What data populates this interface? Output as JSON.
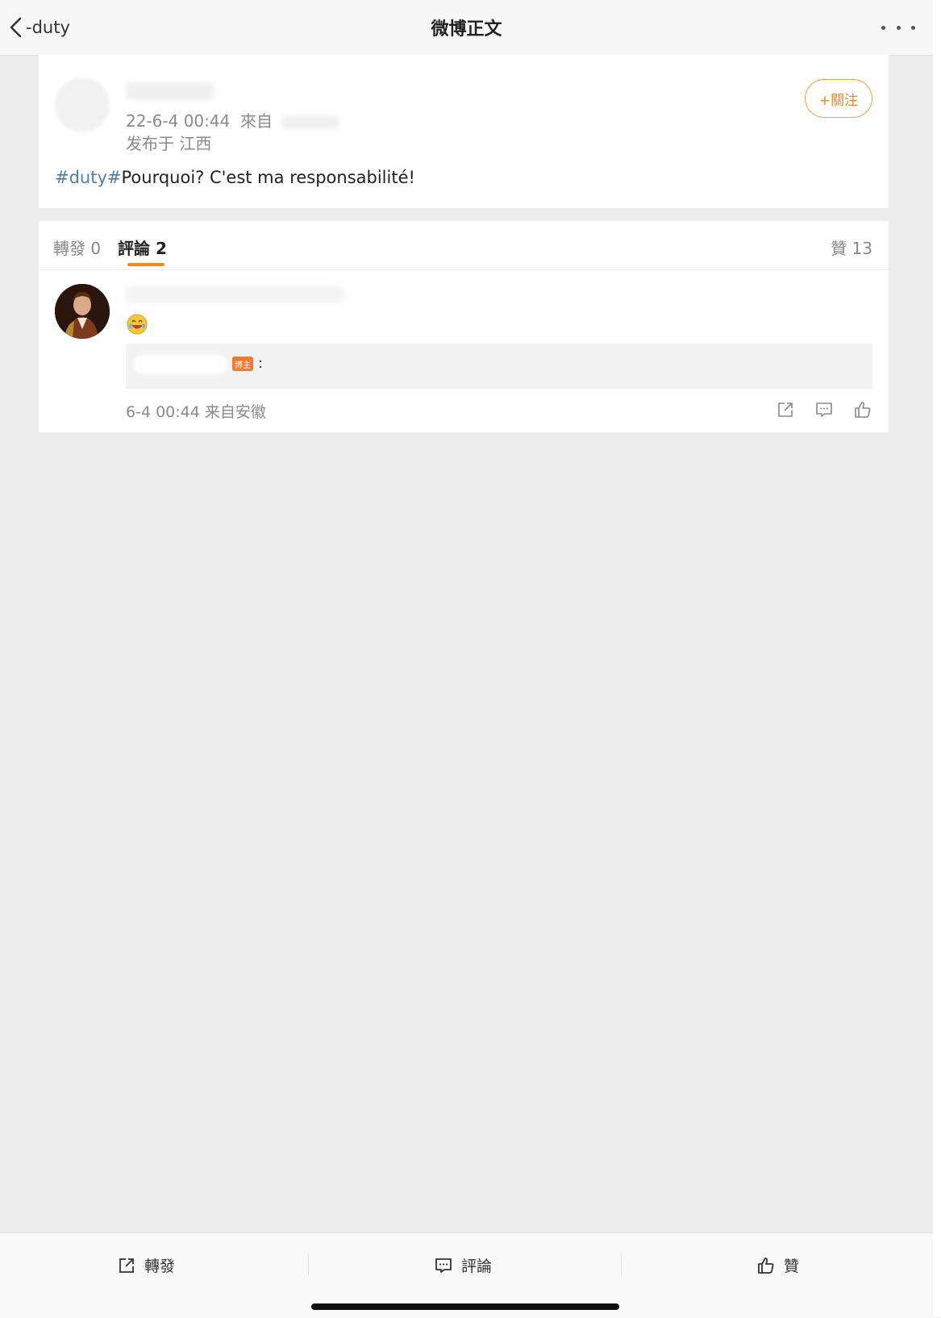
{
  "topbar": {
    "back_label": "-duty",
    "title": "微博正文"
  },
  "post": {
    "datetime": "22-6-4 00:44",
    "source_prefix": "來自",
    "location": "发布于 江西",
    "follow_label": "+關注",
    "topic": "#duty#",
    "text": "Pourquoi? C'est ma responsabilité!"
  },
  "tabs": {
    "repost": "轉發",
    "repost_count": "0",
    "comment": "評論",
    "comment_count": "2",
    "like": "贊",
    "like_count": "13"
  },
  "comment": {
    "badge": "博主",
    "colon": ":",
    "meta": "6-4 00:44 来自安徽"
  },
  "bottombar": {
    "repost": "轉發",
    "comment": "評論",
    "like": "贊"
  },
  "colors": {
    "accent": "#f08a24",
    "topic": "#4f7db3",
    "badge": "#f07a34"
  }
}
